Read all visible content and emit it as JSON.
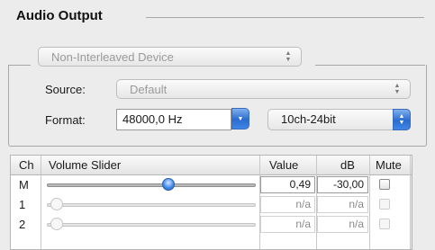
{
  "section": {
    "title": "Audio Output"
  },
  "device_popup": {
    "value": "Non-Interleaved Device"
  },
  "source": {
    "label": "Source:",
    "value": "Default"
  },
  "format": {
    "label": "Format:",
    "sample_rate": "48000,0 Hz",
    "channels": "10ch-24bit"
  },
  "table": {
    "headers": {
      "ch": "Ch",
      "slider": "Volume Slider",
      "value": "Value",
      "db": "dB",
      "mute": "Mute"
    },
    "rows": [
      {
        "ch": "M",
        "value": "0,49",
        "db": "-30,00",
        "level": 0.49
      },
      {
        "ch": "1",
        "value": "n/a",
        "db": "n/a",
        "level": 0
      },
      {
        "ch": "2",
        "value": "n/a",
        "db": "n/a",
        "level": 0
      }
    ]
  },
  "icons": {
    "popup_arrows": "up-down-arrows-icon",
    "scroll_up": "up-arrow-icon",
    "scroll_down": "down-arrow-icon"
  }
}
